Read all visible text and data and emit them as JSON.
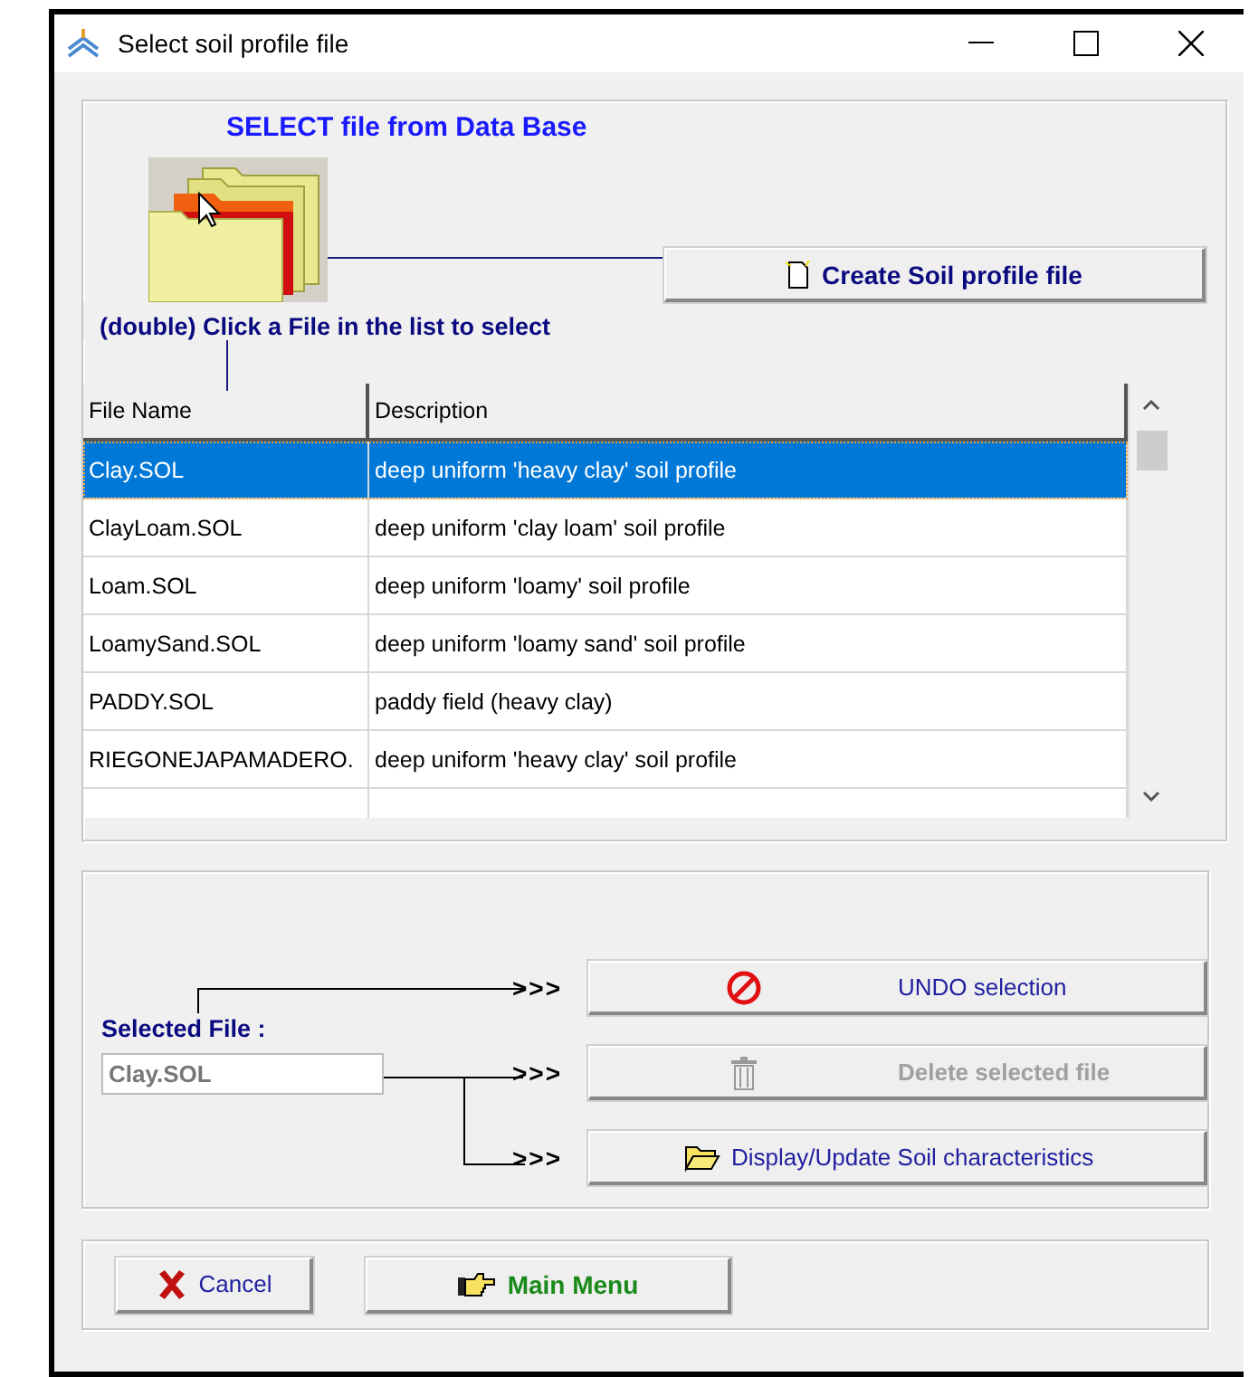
{
  "window": {
    "title": "Select soil profile file"
  },
  "database_panel": {
    "heading": "SELECT file from Data Base",
    "create_button": "Create Soil profile file",
    "hint": "(double) Click a File in the list to select"
  },
  "table": {
    "columns": [
      "File Name",
      "Description"
    ],
    "rows": [
      {
        "file_name": "Clay.SOL",
        "description": "deep uniform 'heavy clay' soil profile",
        "selected": true
      },
      {
        "file_name": "ClayLoam.SOL",
        "description": "deep uniform 'clay loam' soil profile",
        "selected": false
      },
      {
        "file_name": "Loam.SOL",
        "description": "deep uniform 'loamy' soil profile",
        "selected": false
      },
      {
        "file_name": "LoamySand.SOL",
        "description": "deep uniform 'loamy sand' soil profile",
        "selected": false
      },
      {
        "file_name": "PADDY.SOL",
        "description": "paddy field (heavy clay)",
        "selected": false
      },
      {
        "file_name": "RIEGONEJAPAMADERO.",
        "description": "deep uniform 'heavy clay' soil profile",
        "selected": false
      }
    ]
  },
  "selection_panel": {
    "label": "Selected File :",
    "value": "Clay.SOL",
    "actions": [
      {
        "arrow": ">>>",
        "label": "UNDO selection",
        "kind": "undo",
        "disabled": false
      },
      {
        "arrow": ">>>",
        "label": "Delete selected file",
        "kind": "delete",
        "disabled": true
      },
      {
        "arrow": ">>>",
        "label": "Display/Update Soil characteristics",
        "kind": "display",
        "disabled": false
      }
    ]
  },
  "footer": {
    "buttons": [
      {
        "label": "Cancel",
        "kind": "cancel"
      },
      {
        "label": "Main Menu",
        "kind": "main"
      }
    ]
  }
}
